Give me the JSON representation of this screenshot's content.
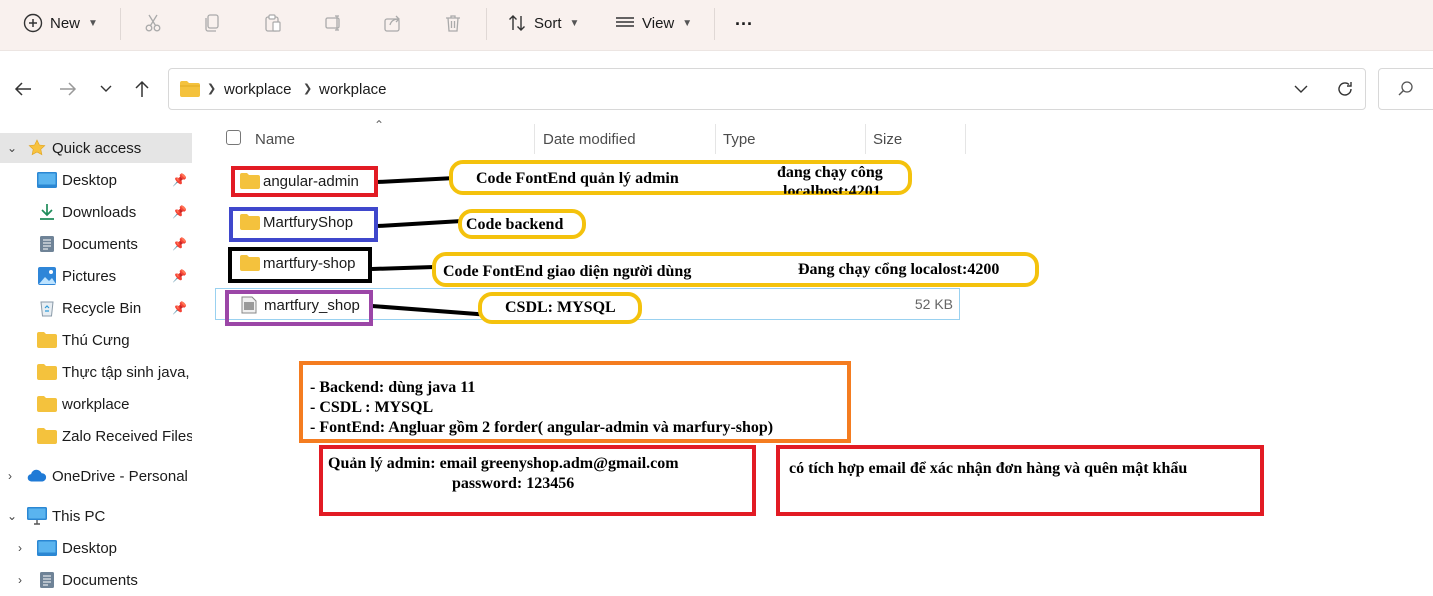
{
  "toolbar": {
    "new_label": "New",
    "sort_label": "Sort",
    "view_label": "View",
    "more_label": "..."
  },
  "address": {
    "crumbs": [
      "workplace",
      "workplace"
    ]
  },
  "sidebar": {
    "items": [
      {
        "label": "Quick access",
        "icon": "star-icon"
      },
      {
        "label": "Desktop",
        "icon": "desktop-icon"
      },
      {
        "label": "Downloads",
        "icon": "download-icon"
      },
      {
        "label": "Documents",
        "icon": "documents-icon"
      },
      {
        "label": "Pictures",
        "icon": "pictures-icon"
      },
      {
        "label": "Recycle Bin",
        "icon": "recycle-bin-icon"
      },
      {
        "label": "Thú Cưng",
        "icon": "folder-icon"
      },
      {
        "label": "Thực tập sinh java, l",
        "icon": "folder-icon"
      },
      {
        "label": "workplace",
        "icon": "folder-icon"
      },
      {
        "label": "Zalo Received Files",
        "icon": "folder-icon"
      },
      {
        "label": "OneDrive - Personal",
        "icon": "cloud-icon"
      },
      {
        "label": "This PC",
        "icon": "computer-icon"
      },
      {
        "label": "Desktop",
        "icon": "desktop-icon"
      },
      {
        "label": "Documents",
        "icon": "documents-icon"
      }
    ]
  },
  "columns": {
    "name": "Name",
    "date_modified": "Date modified",
    "type": "Type",
    "size": "Size"
  },
  "files": [
    {
      "name": "angular-admin",
      "icon": "folder-icon",
      "size": ""
    },
    {
      "name": "MartfuryShop",
      "icon": "folder-icon",
      "size": ""
    },
    {
      "name": "martfury-shop",
      "icon": "folder-icon",
      "size": ""
    },
    {
      "name": "martfury_shop",
      "icon": "sql-file-icon",
      "size": "52 KB"
    }
  ],
  "annotations": {
    "a1": "Code FontEnd quản lý admin",
    "a1b": "đang chạy công",
    "a1c": "localhost:4201",
    "a2": "Code backend",
    "a3": "Code FontEnd giao diện người dùng",
    "a3b": "Đang chạy cổng localost:4200",
    "a4": "CSDL: MYSQL",
    "summary": [
      "- Backend: dùng java 11",
      "- CSDL : MYSQL",
      "- FontEnd: Angluar gồm 2 forder( angular-admin và marfury-shop)"
    ],
    "admin_line1": "Quản lý admin: email greenyshop.adm@gmail.com",
    "admin_line2": "password: 123456",
    "email_note": "có tích hợp email để xác nhận đơn hàng và quên mật khẩu"
  },
  "colors": {
    "red": "#e21b24",
    "blue": "#3f47cc",
    "black": "#000000",
    "purple": "#9b46a7",
    "yellow": "#f4c20d",
    "orange": "#f47c20",
    "folder": "#f4c23d"
  }
}
